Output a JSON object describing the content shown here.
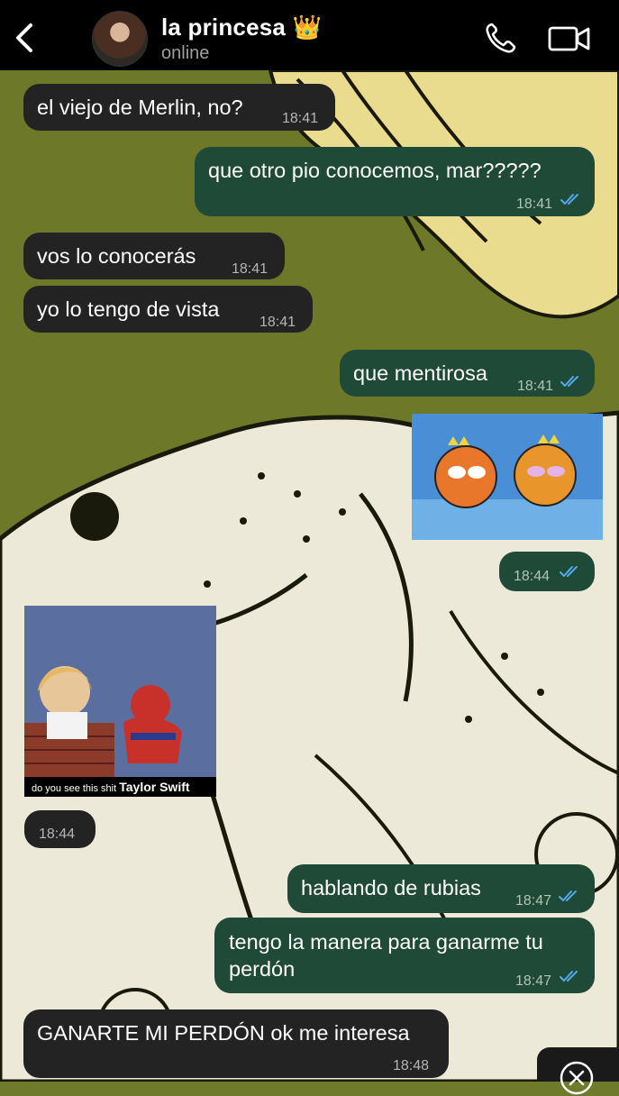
{
  "header": {
    "contact_name": "la princesa",
    "crown_emoji": "👑",
    "status": "online"
  },
  "messages": [
    {
      "text": "el viejo de Merlin, no?",
      "time": "18:41"
    },
    {
      "text": "que otro pio conocemos, mar?????",
      "time": "18:41"
    },
    {
      "text": "vos lo conocerás",
      "time": "18:41"
    },
    {
      "text": "yo lo tengo de vista",
      "time": "18:41"
    },
    {
      "text": "que mentirosa",
      "time": "18:41"
    },
    {
      "time": "18:44"
    },
    {
      "time": "18:44",
      "caption_small": "do you see this shit",
      "caption_bold": "Taylor Swift"
    },
    {
      "text": "hablando de rubias",
      "time": "18:47"
    },
    {
      "text_line1": "tengo la manera para ganarme tu",
      "text_line2": "perdón",
      "time": "18:47"
    },
    {
      "text": "GANARTE MI PERDÓN ok me interesa",
      "time": "18:48"
    }
  ],
  "colors": {
    "header_bg": "#000000",
    "incoming_bubble": "#232323",
    "outgoing_bubble": "#1f4a37",
    "read_ticks": "#55a9ef",
    "wallpaper": "#6d7828"
  }
}
